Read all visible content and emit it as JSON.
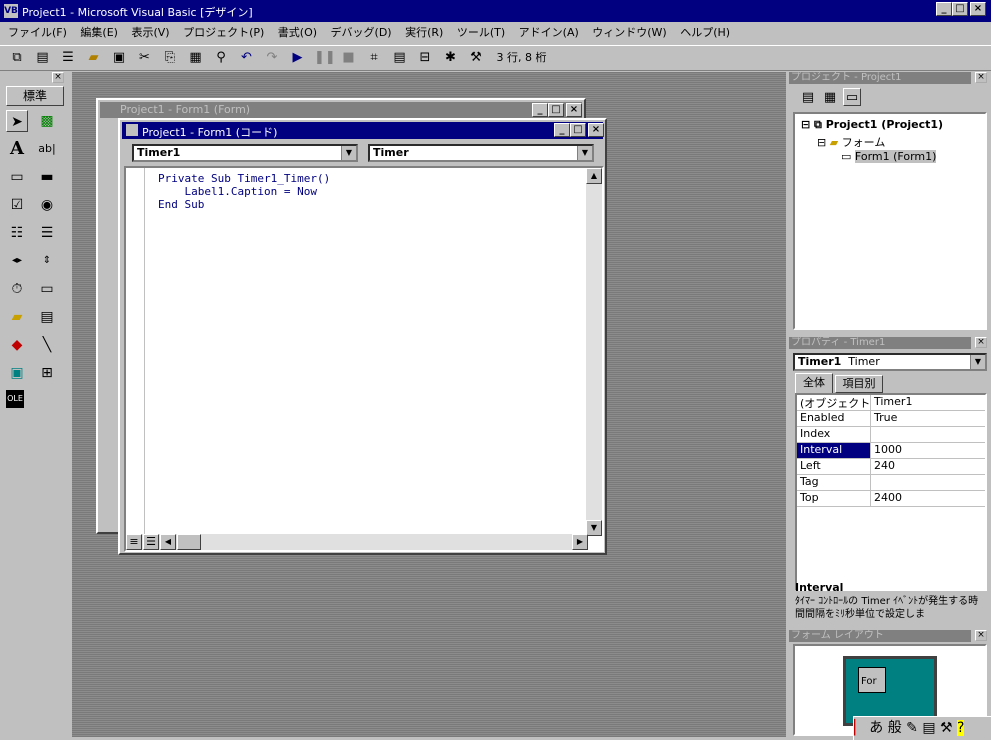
{
  "window": {
    "title": "Project1 - Microsoft Visual Basic [デザイン]"
  },
  "menu": [
    "ファイル(F)",
    "編集(E)",
    "表示(V)",
    "プロジェクト(P)",
    "書式(O)",
    "デバッグ(D)",
    "実行(R)",
    "ツール(T)",
    "アドイン(A)",
    "ウィンドウ(W)",
    "ヘルプ(H)"
  ],
  "toolbar": {
    "position": "3 行, 8 桁"
  },
  "toolbox": {
    "title": "標準"
  },
  "form_window": {
    "title": "Project1 - Form1 (Form)"
  },
  "code_window": {
    "title": "Project1 - Form1 (コード)",
    "object_combo": "Timer1",
    "proc_combo": "Timer",
    "lines": [
      "Private Sub Timer1_Timer()",
      "    Label1.Caption = Now",
      "End Sub"
    ]
  },
  "project_panel": {
    "title": "プロジェクト - Project1",
    "root": "Project1 (Project1)",
    "folder": "フォーム",
    "item": "Form1 (Form1)"
  },
  "properties_panel": {
    "title": "プロパティ - Timer1",
    "object_name": "Timer1",
    "object_type": "Timer",
    "tab_all": "全体",
    "tab_category": "項目別",
    "rows": [
      {
        "key": "(オブジェクト名)",
        "value": "Timer1"
      },
      {
        "key": "Enabled",
        "value": "True"
      },
      {
        "key": "Index",
        "value": ""
      },
      {
        "key": "Interval",
        "value": "1000"
      },
      {
        "key": "Left",
        "value": "240"
      },
      {
        "key": "Tag",
        "value": ""
      },
      {
        "key": "Top",
        "value": "2400"
      }
    ],
    "desc_title": "Interval",
    "desc_text": "ﾀｲﾏｰ ｺﾝﾄﾛｰﾙの Timer ｲﾍﾞﾝﾄが発生する時間間隔をﾐﾘ秒単位で設定しま"
  },
  "layout_panel": {
    "title": "フォーム レイアウト",
    "preview_label": "For"
  },
  "ime": {
    "mode_a": "あ",
    "mode_b": "般"
  }
}
